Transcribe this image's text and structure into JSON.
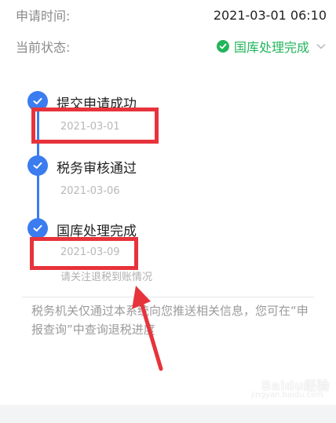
{
  "header": {
    "apply_time_label": "申请时间:",
    "apply_time_value": "2021-03-01 06:10",
    "status_label": "当前状态:",
    "status_value": "国库处理完成"
  },
  "timeline": {
    "steps": [
      {
        "title": "提交申请成功",
        "date": "2021-03-01"
      },
      {
        "title": "税务审核通过",
        "date": "2021-03-06"
      },
      {
        "title": "国库处理完成",
        "date": "2021-03-09",
        "note": "请关注退税到账情况"
      }
    ]
  },
  "info_text": "税务机关仅通过本系统向您推送相关信息，您可在“申报查询”中查询退税进度",
  "watermark": {
    "main": "Baidu经验",
    "sub": "jingyan.baidu.com"
  },
  "colors": {
    "accent_blue": "#3b7cf0",
    "status_green": "#23b45c",
    "highlight_red": "#e7333b"
  }
}
